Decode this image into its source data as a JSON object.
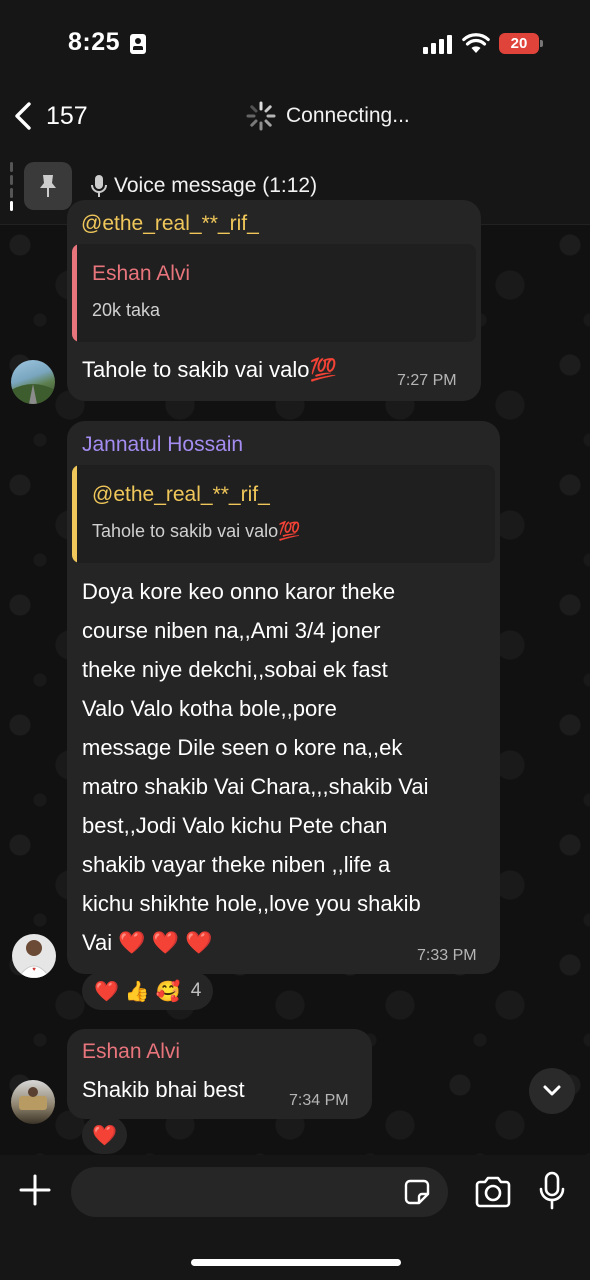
{
  "status_bar": {
    "time": "8:25",
    "battery": "20"
  },
  "header": {
    "back_count": "157",
    "status": "Connecting..."
  },
  "pinned": {
    "label": "Voice message (1:12)"
  },
  "messages": [
    {
      "top_cut_name": "@ethe_real_**_rif_",
      "quote_name": "Eshan Alvi",
      "quote_text": "20k taka",
      "text": "Tahole to sakib vai valo💯",
      "time": "7:27 PM"
    },
    {
      "sender": "Jannatul Hossain",
      "quote_name": "@ethe_real_**_rif_",
      "quote_text": "Tahole to sakib vai valo💯",
      "lines": [
        "Doya kore keo onno karor theke",
        "course niben na,,Ami 3/4 joner",
        "theke niye dekchi,,sobai ek fast",
        "Valo Valo kotha bole,,pore",
        "message Dile seen o kore na,,ek",
        "matro shakib Vai Chara,,,shakib Vai",
        "best,,Jodi Valo kichu Pete chan",
        "shakib vayar theke niben ,,life a",
        "kichu shikhte hole,,love you shakib",
        "Vai ❤️ ❤️ ❤️"
      ],
      "time": "7:33 PM",
      "reactions": [
        "❤️",
        "👍",
        "🥰"
      ],
      "reaction_count": "4"
    },
    {
      "sender": "Eshan Alvi",
      "text": "Shakib bhai best",
      "time": "7:34 PM",
      "reactions": [
        "❤️"
      ]
    }
  ],
  "input": {
    "placeholder": ""
  },
  "colors": {
    "eshan": "#e8747c",
    "jannatul": "#a48cf0",
    "ethe": "#f0c75a",
    "bubble": "#252525"
  }
}
